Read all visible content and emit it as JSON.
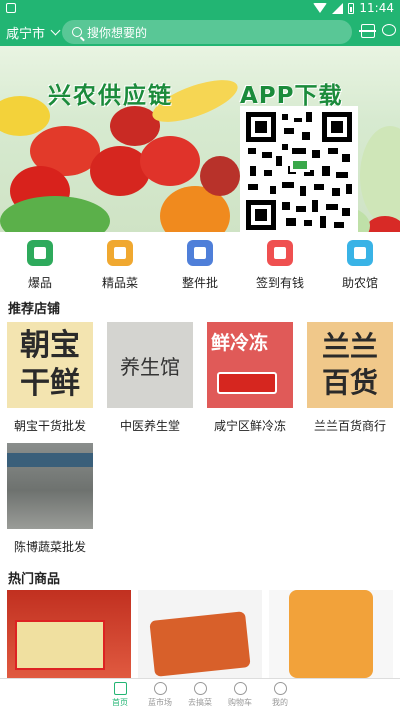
{
  "status_bar": {
    "time": "11:44"
  },
  "header": {
    "city": "咸宁市",
    "search_placeholder": "搜你想要的"
  },
  "banner": {
    "title": "兴农供应链",
    "app_text": "APP下载"
  },
  "categories": [
    {
      "label": "爆品",
      "color": "#2eaa5c"
    },
    {
      "label": "精品菜",
      "color": "#f0a830"
    },
    {
      "label": "整件批",
      "color": "#4f7fd9"
    },
    {
      "label": "签到有钱",
      "color": "#ef5050"
    },
    {
      "label": "助农馆",
      "color": "#39b3e6"
    }
  ],
  "recommended_shops": {
    "title": "推荐店铺",
    "items": [
      {
        "name": "朝宝干货批发",
        "sign_text": "朝宝\n干鲜"
      },
      {
        "name": "中医养生堂",
        "sign_text": "养生馆"
      },
      {
        "name": "咸宁区鲜冷冻",
        "sign_text": "鲜冷冻"
      },
      {
        "name": "兰兰百货商行",
        "sign_text": "兰兰\n百货"
      },
      {
        "name": "陈博蔬菜批发",
        "sign_text": ""
      }
    ]
  },
  "hot_products": {
    "title": "热门商品"
  },
  "tab_bar": {
    "items": [
      {
        "label": "首页",
        "active": true
      },
      {
        "label": "蓝市场",
        "active": false
      },
      {
        "label": "去搞菜",
        "active": false
      },
      {
        "label": "购物车",
        "active": false
      },
      {
        "label": "我的",
        "active": false
      }
    ]
  }
}
